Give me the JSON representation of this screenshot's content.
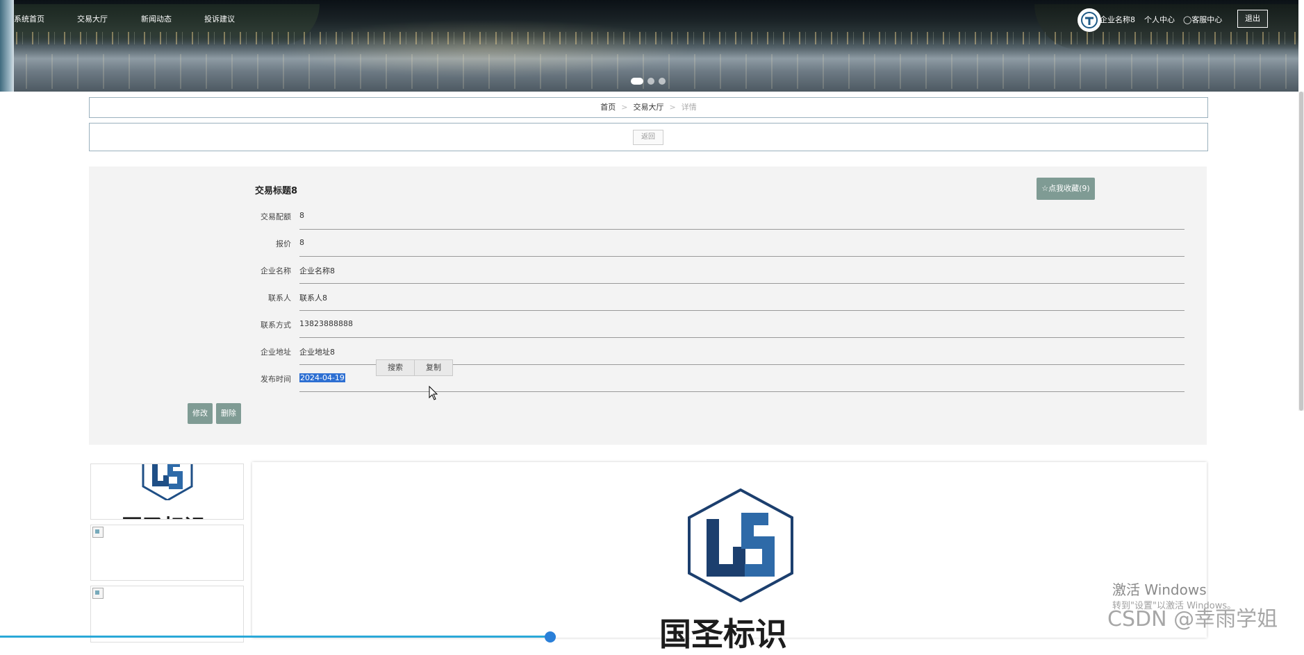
{
  "nav": {
    "items": [
      "系统首页",
      "交易大厅",
      "新闻动态",
      "投诉建议"
    ]
  },
  "header": {
    "company": "企业名称8",
    "personal_center": "个人中心",
    "service_center": "客服中心",
    "logout": "退出"
  },
  "breadcrumb": {
    "home": "首页",
    "hall": "交易大厅",
    "current": "详情",
    "separator": ">"
  },
  "back_button": "返回",
  "detail": {
    "title": "交易标题8",
    "favorite_label": "☆点我收藏(9)",
    "fields": [
      {
        "label": "交易配额",
        "value": "8"
      },
      {
        "label": "报价",
        "value": "8"
      },
      {
        "label": "企业名称",
        "value": "企业名称8"
      },
      {
        "label": "联系人",
        "value": "联系人8"
      },
      {
        "label": "联系方式",
        "value": "13823888888"
      },
      {
        "label": "企业地址",
        "value": "企业地址8"
      },
      {
        "label": "发布时间",
        "value": "2024-04-19"
      }
    ],
    "edit_button": "修改",
    "delete_button": "删除"
  },
  "context_menu": {
    "search": "搜索",
    "copy": "复制"
  },
  "gallery": {
    "logo_text": "国圣标识"
  },
  "overlay": {
    "windows_activate": "激活 Windows",
    "windows_activate_sub": "转到\"设置\"以激活 Windows。",
    "watermark": "CSDN @幸雨学姐"
  },
  "colors": {
    "accent_button": "#7f9b94",
    "selection": "#2d6fd2",
    "logo_blue": "#1f4f86"
  }
}
